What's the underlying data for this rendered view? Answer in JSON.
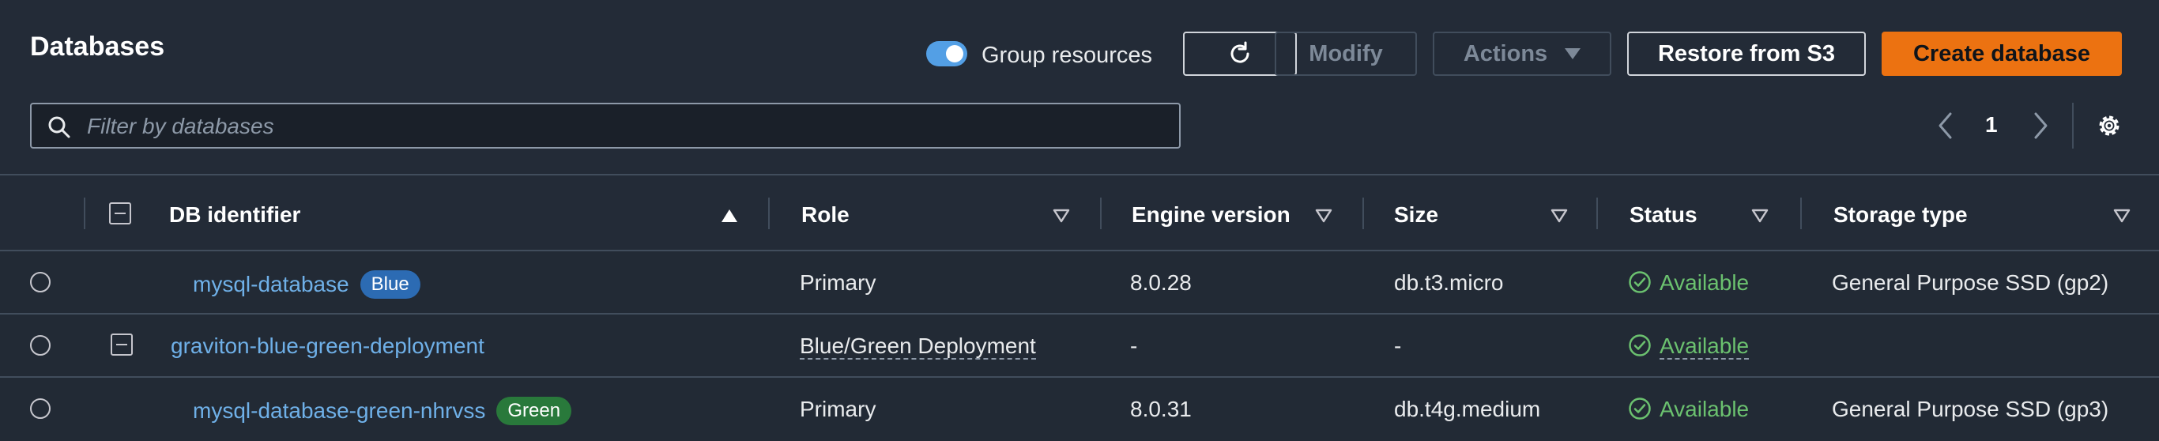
{
  "page": {
    "title": "Databases",
    "group_resources_label": "Group resources",
    "group_resources_on": true
  },
  "toolbar": {
    "modify_label": "Modify",
    "actions_label": "Actions",
    "restore_label": "Restore from S3",
    "create_label": "Create database"
  },
  "search": {
    "placeholder": "Filter by databases"
  },
  "pagination": {
    "current_page": "1"
  },
  "table": {
    "headers": {
      "db_identifier": "DB identifier",
      "role": "Role",
      "engine_version": "Engine version",
      "size": "Size",
      "status": "Status",
      "storage_type": "Storage type"
    },
    "rows": [
      {
        "db_identifier": "mysql-database",
        "badge": "Blue",
        "role": "Primary",
        "engine_version": "8.0.28",
        "size": "db.t3.micro",
        "status": "Available",
        "storage_type": "General Purpose SSD (gp2)"
      },
      {
        "db_identifier": "graviton-blue-green-deployment",
        "badge": "",
        "role": "Blue/Green Deployment",
        "engine_version": "-",
        "size": "-",
        "status": "Available",
        "storage_type": ""
      },
      {
        "db_identifier": "mysql-database-green-nhrvss",
        "badge": "Green",
        "role": "Primary",
        "engine_version": "8.0.31",
        "size": "db.t4g.medium",
        "status": "Available",
        "storage_type": "General Purpose SSD (gp3)"
      }
    ]
  },
  "colors": {
    "accent": "#ec7211",
    "link": "#6fb0e8",
    "status_ok": "#6bc16f",
    "badge_blue": "#2c6bb3",
    "badge_green": "#29793b"
  }
}
